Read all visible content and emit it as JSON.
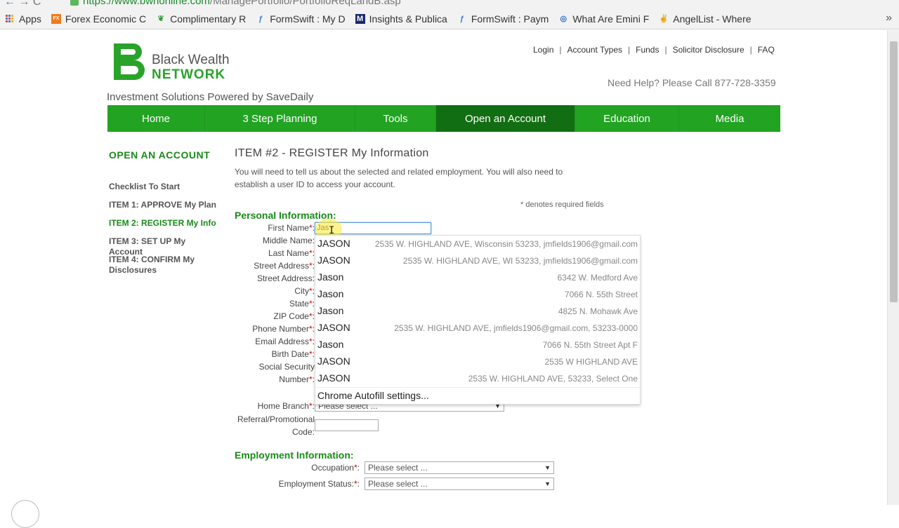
{
  "browser": {
    "url_host": "https://www.bwnonline.com",
    "url_path": "/ManagePortfolio/PortfolioReqLandB.asp",
    "bookmarks": [
      {
        "label": "Apps",
        "icon": "apps-grid-icon"
      },
      {
        "label": "Forex Economic C",
        "icon": "forex-icon"
      },
      {
        "label": "Complimentary R",
        "icon": "leaf-icon"
      },
      {
        "label": "FormSwift : My D",
        "icon": "formswift-icon"
      },
      {
        "label": "Insights & Publica",
        "icon": "m-logo-icon"
      },
      {
        "label": "FormSwift : Paym",
        "icon": "formswift-icon"
      },
      {
        "label": "What Are Emini F",
        "icon": "swirl-icon"
      },
      {
        "label": "AngelList - Where",
        "icon": "hand-icon"
      }
    ],
    "more": "»"
  },
  "header": {
    "logo_line1": "Black Wealth",
    "logo_line2": "NETWORK",
    "tagline": "Investment Solutions Powered by SaveDaily",
    "top_links": [
      "Login",
      "Account Types",
      "Funds",
      "Solicitor Disclosure",
      "FAQ"
    ],
    "help": "Need Help? Please Call 877-728-3359"
  },
  "nav": {
    "items": [
      "Home",
      "3 Step Planning",
      "Tools",
      "Open an Account",
      "Education",
      "Media"
    ],
    "active": "Open an Account"
  },
  "sidebar": {
    "title": "OPEN AN ACCOUNT",
    "items": [
      "Checklist To Start",
      "ITEM 1: APPROVE My Plan",
      "ITEM 2: REGISTER My Info",
      "ITEM 3: SET UP My Account",
      "ITEM 4: CONFIRM My Disclosures"
    ],
    "active": "ITEM 2: REGISTER My Info"
  },
  "main": {
    "heading": "ITEM #2 - REGISTER My Information",
    "intro": "You will need to tell us about the selected and related employment. You will also need to establish a user ID to access your account.",
    "required_note": "* denotes required fields",
    "personal_title": "Personal Information:",
    "employment_title": "Employment Information:",
    "fields": {
      "first_name": "First Name",
      "middle_name": "Middle Name",
      "last_name": "Last Name",
      "street1": "Street Address",
      "street2": "Street Address",
      "city": "City",
      "state": "State",
      "zip": "ZIP Code",
      "phone": "Phone Number",
      "email": "Email Address",
      "birth": "Birth Date",
      "ssn_line1": "Social Security",
      "ssn_line2": "Number",
      "home_branch": "Home Branch",
      "referral_line1": "Referral/Promotional",
      "referral_line2": "Code:",
      "occupation": "Occupation",
      "employment_status": "Employment Status:"
    },
    "first_name_value": "Jas",
    "select_placeholder": "Please select ...",
    "star": "*",
    "colon": ":"
  },
  "autofill": {
    "rows": [
      {
        "name": "JASON",
        "detail": "2535 W. HIGHLAND AVE, Wisconsin 53233, jmfields1906@gmail.com"
      },
      {
        "name": "JASON",
        "detail": "2535 W. HIGHLAND AVE, WI 53233, jmfields1906@gmail.com"
      },
      {
        "name": "Jason",
        "detail": "6342 W. Medford Ave"
      },
      {
        "name": "Jason",
        "detail": "7066 N. 55th Street"
      },
      {
        "name": "Jason",
        "detail": "4825 N. Mohawk Ave"
      },
      {
        "name": "JASON",
        "detail": "2535 W. HIGHLAND AVE, jmfields1906@gmail.com, 53233-0000"
      },
      {
        "name": "Jason",
        "detail": "7066 N. 55th Street Apt F"
      },
      {
        "name": "JASON",
        "detail": "2535 W HIGHLAND AVE"
      },
      {
        "name": "JASON",
        "detail": "2535 W. HIGHLAND AVE, 53233, Select One"
      }
    ],
    "footer": "Chrome Autofill settings..."
  },
  "colors": {
    "brand_green": "#22a322",
    "active_nav": "#126e12",
    "heading_green": "#1a8a1a"
  }
}
